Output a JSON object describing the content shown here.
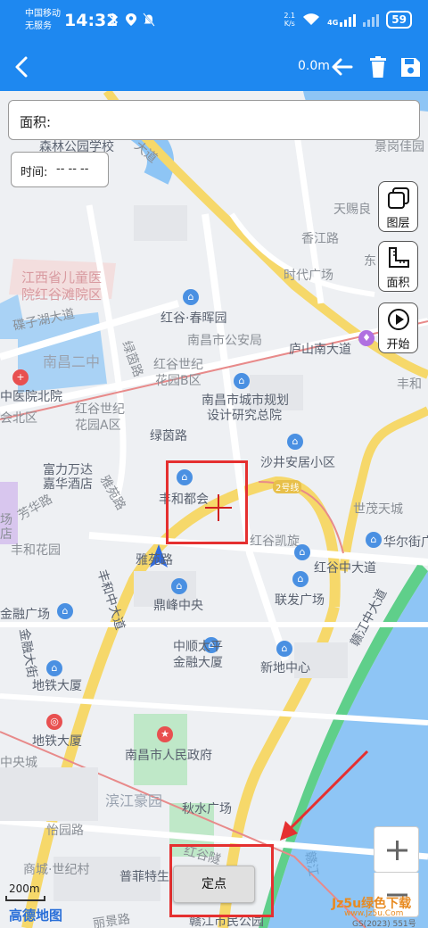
{
  "status_bar": {
    "carrier_line1": "中国移动",
    "carrier_line2": "无服务",
    "time": "14:32",
    "net_speed_value": "2.1",
    "net_speed_unit": "K/s",
    "signal_type": "4G",
    "battery": "59"
  },
  "toolbar": {
    "distance": "0.0m",
    "icons": [
      "back-icon",
      "undo-arrow-icon",
      "trash-icon",
      "save-icon"
    ]
  },
  "info_panel": {
    "area_label": "面积:",
    "time_label": "时间:",
    "time_value": "-- -- --"
  },
  "side_buttons": [
    {
      "label": "图层",
      "icon": "layers-icon"
    },
    {
      "label": "面积",
      "icon": "ruler-icon"
    },
    {
      "label": "开始",
      "icon": "play-icon"
    }
  ],
  "map_labels": {
    "l1": "森林公园学校",
    "l2": "大道",
    "l3": "景岗佳园",
    "l4": "天赐良",
    "l5": "香江路",
    "l6": "江西省儿童医",
    "l7": "院红谷滩院区",
    "l8": "时代广场",
    "l9": "东",
    "l10": "碟子湖大道",
    "l11": "红谷·春晖园",
    "l12": "南昌二中",
    "l13": "南昌市公安局",
    "l14": "庐山南大道",
    "l15": "绿茵路",
    "l16": "红谷世纪",
    "l17": "花园B区",
    "l18": "丰和",
    "l19": "中医院北院",
    "l20": "南昌市城市规划",
    "l21": "设计研究总院",
    "l22": "红谷世纪",
    "l23": "花园A区",
    "l24": "会北区",
    "l25": "绿茵路",
    "l26": "沙井安居小区",
    "l27": "富力万达",
    "l28": "嘉华酒店",
    "l29": "雅苑路",
    "l30": "丰和都会",
    "l31": "2号线",
    "l32": "世茂天城",
    "l33": "芳华路",
    "l34": "丰和花园",
    "l35": "红谷凯旋",
    "l36": "华尔街广",
    "l37": "雅苑路",
    "l38": "红谷中大道",
    "l39": "丰和中大道",
    "l40": "鼎峰中央",
    "l41": "联发广场",
    "l42": "金融广场",
    "l43": "赣江中大道",
    "l44": "金融大街",
    "l45": "中顺太平",
    "l46": "金融大厦",
    "l47": "新地中心",
    "l48": "地铁大厦",
    "l49": "地铁大厦",
    "l50": "中央城",
    "l51": "南昌市人民政府",
    "l52": "滨江豪园",
    "l53": "秋水广场",
    "l54": "怡园路",
    "l55": "商城·世纪村",
    "l56": "普菲特生",
    "l57": "红谷隧",
    "l58": "赣江市民公园",
    "l59": "丽景路",
    "l60": "赣江",
    "l61": "场",
    "l62": "店"
  },
  "locate_button": "定点",
  "zoom": {
    "in": "+",
    "out": "−"
  },
  "scale": "200m",
  "map_logo": "高德地图",
  "copyright": "GS(2023) 551号",
  "watermark": "Jz5u绿色下载",
  "watermark_sub": "www.Jz5u.Com",
  "colors": {
    "accent": "#1e88f0",
    "highlight_red": "#e53030",
    "river": "#8ec5f5",
    "green_bank": "#5fcf8a",
    "main_road": "#f6d86a"
  }
}
